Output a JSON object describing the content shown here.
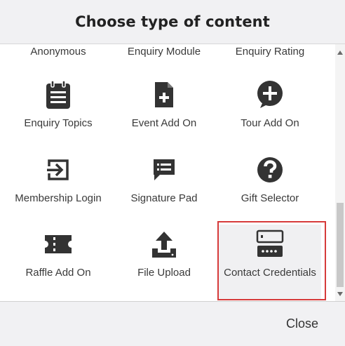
{
  "dialog": {
    "title": "Choose type of content",
    "close_label": "Close"
  },
  "tiles": {
    "anonymous": "Anonymous",
    "enquiry_module": "Enquiry Module",
    "enquiry_rating": "Enquiry Rating",
    "enquiry_topics": "Enquiry Topics",
    "event_add_on": "Event Add On",
    "tour_add_on": "Tour Add On",
    "membership_login": "Membership Login",
    "signature_pad": "Signature Pad",
    "gift_selector": "Gift Selector",
    "raffle_add_on": "Raffle Add On",
    "file_upload": "File Upload",
    "contact_credentials": "Contact Credentials"
  },
  "colors": {
    "icon": "#333333",
    "highlight": "#d63a3a",
    "body_bg": "#ffffff",
    "chrome_bg": "#f1f1f3"
  }
}
